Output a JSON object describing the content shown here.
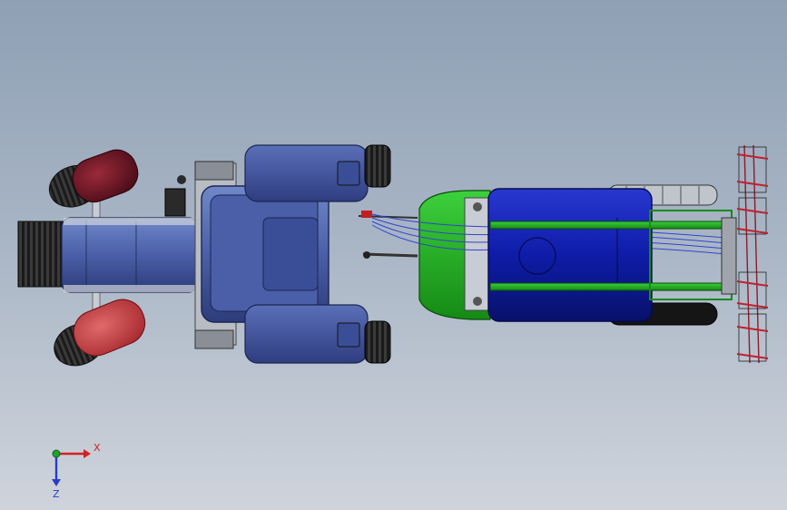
{
  "viewport": {
    "background_top": "#8fa0b5",
    "background_bottom": "#cfd4dc"
  },
  "triad": {
    "x_label": "X",
    "z_label": "Z",
    "x_color": "#d42020",
    "y_color": "#22a030",
    "z_color": "#2a3cc8"
  },
  "model": {
    "tractor_cab_color": "#4a5fa8",
    "rear_fender_color": "#3f4f9a",
    "front_wheel_left_color": "#6e1424",
    "front_wheel_right_color": "#c43a40",
    "implement_frame_color": "#22a822",
    "tank_color": "#0f1fa8",
    "harrow_color": "#8c1c28"
  }
}
